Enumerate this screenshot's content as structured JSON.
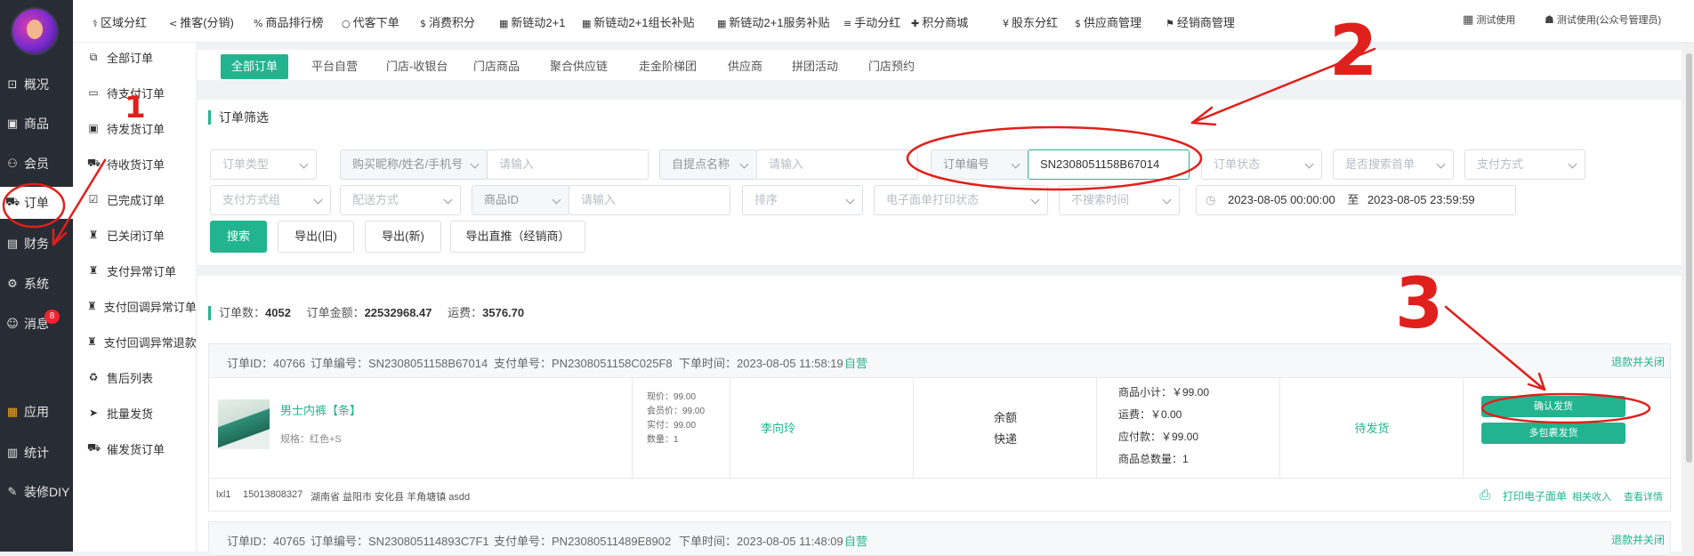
{
  "leftnav": {
    "items": [
      {
        "label": "概况",
        "icon": "chart-icon"
      },
      {
        "label": "商品",
        "icon": "product-icon"
      },
      {
        "label": "会员",
        "icon": "member-icon"
      },
      {
        "label": "订单",
        "icon": "cart-icon"
      },
      {
        "label": "财务",
        "icon": "finance-icon"
      },
      {
        "label": "系统",
        "icon": "gear-icon"
      },
      {
        "label": "消息",
        "icon": "message-icon",
        "badge": "8"
      },
      {
        "label": "应用",
        "icon": "apps-icon"
      },
      {
        "label": "统计",
        "icon": "stats-icon"
      },
      {
        "label": "装修DIY",
        "icon": "brush-icon"
      }
    ]
  },
  "subnav": {
    "items": [
      {
        "label": "全部订单"
      },
      {
        "label": "待支付订单"
      },
      {
        "label": "待发货订单"
      },
      {
        "label": "待收货订单"
      },
      {
        "label": "已完成订单"
      },
      {
        "label": "已关闭订单"
      },
      {
        "label": "支付异常订单"
      },
      {
        "label": "支付回调异常订单"
      },
      {
        "label": "支付回调异常退款"
      },
      {
        "label": "售后列表"
      },
      {
        "label": "批量发货"
      },
      {
        "label": "催发货订单"
      }
    ]
  },
  "topnav": {
    "items": [
      {
        "label": "区域分红",
        "icon": "⚕"
      },
      {
        "label": "推客(分销)",
        "icon": "<"
      },
      {
        "label": "商品排行榜",
        "icon": "%"
      },
      {
        "label": "代客下单",
        "icon": "○"
      },
      {
        "label": "消费积分",
        "icon": "$"
      },
      {
        "label": "新链动2+1",
        "icon": "▦"
      },
      {
        "label": "新链动2+1组长补贴",
        "icon": "▦"
      },
      {
        "label": "新链动2+1服务补贴",
        "icon": "▦"
      },
      {
        "label": "手动分红",
        "icon": "≡"
      },
      {
        "label": "积分商城",
        "icon": "✚"
      },
      {
        "label": "股东分红",
        "icon": "¥"
      },
      {
        "label": "供应商管理",
        "icon": "$"
      },
      {
        "label": "经销商管理",
        "icon": "⚑"
      }
    ],
    "right": {
      "shop": "测试使用",
      "user": "测试使用(公众号管理员)"
    }
  },
  "tabs": [
    "全部订单",
    "平台自营",
    "门店-收银台",
    "门店商品",
    "聚合供应链",
    "走金阶梯团",
    "供应商",
    "拼团活动",
    "门店预约"
  ],
  "filter": {
    "title": "订单筛选",
    "order_type": "订单类型",
    "buyer_field": "购买昵称/姓名/手机号",
    "placeholder": "请输入",
    "pickup_name": "自提点名称",
    "order_no_field": "订单编号",
    "order_no_value": "SN2308051158B67014",
    "order_status": "订单状态",
    "search_first": "是否搜索首单",
    "pay_method": "支付方式",
    "pay_group": "支付方式组",
    "delivery": "配送方式",
    "goods_id": "商品ID",
    "sort": "排序",
    "eface_status": "电子面单打印状态",
    "time_search": "不搜索时间",
    "date_start": "2023-08-05 00:00:00",
    "date_sep": "至",
    "date_end": "2023-08-05 23:59:59",
    "buttons": {
      "search": "搜索",
      "export_old": "导出(旧)",
      "export_new": "导出(新)",
      "export_direct": "导出直推（经销商）"
    }
  },
  "summary": {
    "count_label": "订单数：",
    "count": "4052",
    "amount_label": "订单金额：",
    "amount": "22532968.47",
    "freight_label": "运费：",
    "freight": "3576.70"
  },
  "orders": [
    {
      "id_label": "订单ID：",
      "id": "40766",
      "no_label": "订单编号：",
      "no": "SN2308051158B67014",
      "pay_label": "支付单号：",
      "pay_no": "PN2308051158C025F8",
      "time_label": "下单时间：",
      "time": "2023-08-05 11:58:19",
      "tag": "自营",
      "refund_close": "退款并关闭",
      "product": {
        "name": "男士内裤【条】",
        "spec": "规格：红色+S"
      },
      "prices": {
        "current": "现价：99.00",
        "member": "会员价：99.00",
        "paid": "实付：99.00",
        "qty": "数量：1"
      },
      "buyer": "李向玲",
      "pay_type": "余额",
      "ship_type": "快递",
      "totals": {
        "subtotal": "商品小计：￥99.00",
        "freight": "运费：￥0.00",
        "payable": "应付款：￥99.00",
        "total_qty": "商品总数量：1"
      },
      "status": "待发货",
      "actions": {
        "confirm": "确认发货",
        "multi": "多包裹发货"
      },
      "footer": {
        "name": "lxl1",
        "phone": "15013808327",
        "address": "湖南省 益阳市 安化县 羊角塘镇 asdd",
        "print": "打印电子面单",
        "income": "相关收入",
        "detail": "查看详情"
      }
    },
    {
      "id_label": "订单ID：",
      "id": "40765",
      "no_label": "订单编号：",
      "no": "SN230805114893C7F1",
      "pay_label": "支付单号：",
      "pay_no": "PN23080511489E8902",
      "time_label": "下单时间：",
      "time": "2023-08-05 11:48:09",
      "tag": "自营",
      "refund_close": "退款并关闭"
    }
  ],
  "annotations": {
    "n1": "1",
    "n2": "2",
    "n3": "3",
    "color": "#e0201c"
  }
}
